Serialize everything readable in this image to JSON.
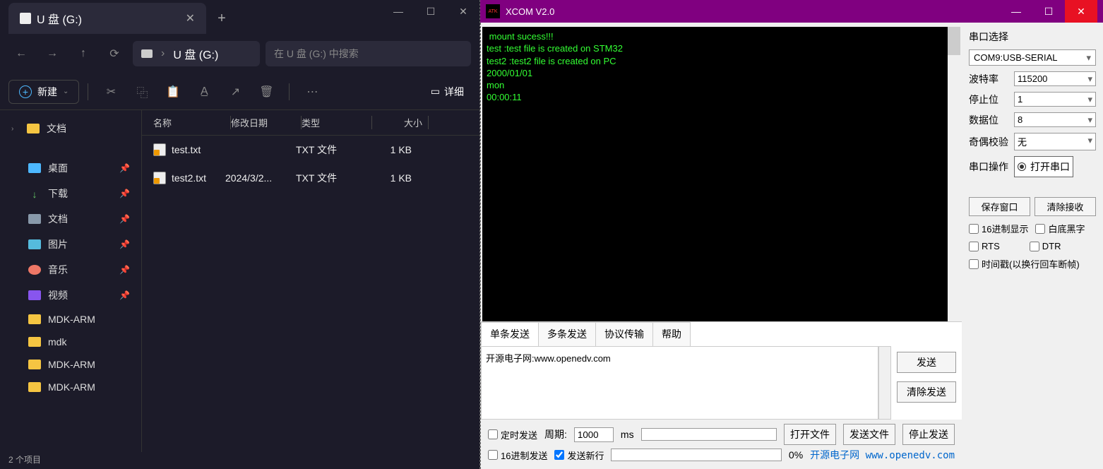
{
  "explorer": {
    "tab_title": "U 盘 (G:)",
    "breadcrumb": "U 盘 (G:)",
    "search_placeholder": "在 U 盘 (G:) 中搜索",
    "new_btn": "新建",
    "details_btn": "详细",
    "headers": {
      "name": "名称",
      "date": "修改日期",
      "type": "类型",
      "size": "大小"
    },
    "tree": {
      "docs_top": "文档",
      "desktop": "桌面",
      "downloads": "下载",
      "documents": "文档",
      "pictures": "图片",
      "music": "音乐",
      "videos": "视频",
      "mdk1": "MDK-ARM",
      "mdk2": "mdk",
      "mdk3": "MDK-ARM",
      "mdk4": "MDK-ARM"
    },
    "files": [
      {
        "name": "test.txt",
        "date": "",
        "type": "TXT 文件",
        "size": "1 KB"
      },
      {
        "name": "test2.txt",
        "date": "2024/3/2...",
        "type": "TXT 文件",
        "size": "1 KB"
      }
    ],
    "status": "2 个项目"
  },
  "xcom": {
    "title": "XCOM V2.0",
    "terminal": " mount sucess!!!\ntest :test file is created on STM32\ntest2 :test2 file is created on PC\n2000/01/01\nmon\n00:00:11",
    "side": {
      "port_label": "串口选择",
      "port_value": "COM9:USB-SERIAL",
      "baud_label": "波特率",
      "baud_value": "115200",
      "stop_label": "停止位",
      "stop_value": "1",
      "data_label": "数据位",
      "data_value": "8",
      "parity_label": "奇偶校验",
      "parity_value": "无",
      "op_label": "串口操作",
      "op_btn": "打开串口",
      "save_btn": "保存窗口",
      "clear_btn": "清除接收",
      "hex_disp": "16进制显示",
      "white_bg": "白底黑字",
      "rts": "RTS",
      "dtr": "DTR",
      "timestamp": "时间戳(以换行回车断帧)"
    },
    "tabs": {
      "single": "单条发送",
      "multi": "多条发送",
      "proto": "协议传输",
      "help": "帮助"
    },
    "send_text": "开源电子网:www.openedv.com",
    "send_btn": "发送",
    "clear_send_btn": "清除发送",
    "bottom": {
      "timed": "定时发送",
      "period_lbl": "周期:",
      "period_val": "1000",
      "period_unit": "ms",
      "open_file": "打开文件",
      "send_file": "发送文件",
      "stop_send": "停止发送",
      "hex_send": "16进制发送",
      "send_newline": "发送新行",
      "progress": "0%"
    },
    "footer_link": "开源电子网   www.openedv.com"
  }
}
